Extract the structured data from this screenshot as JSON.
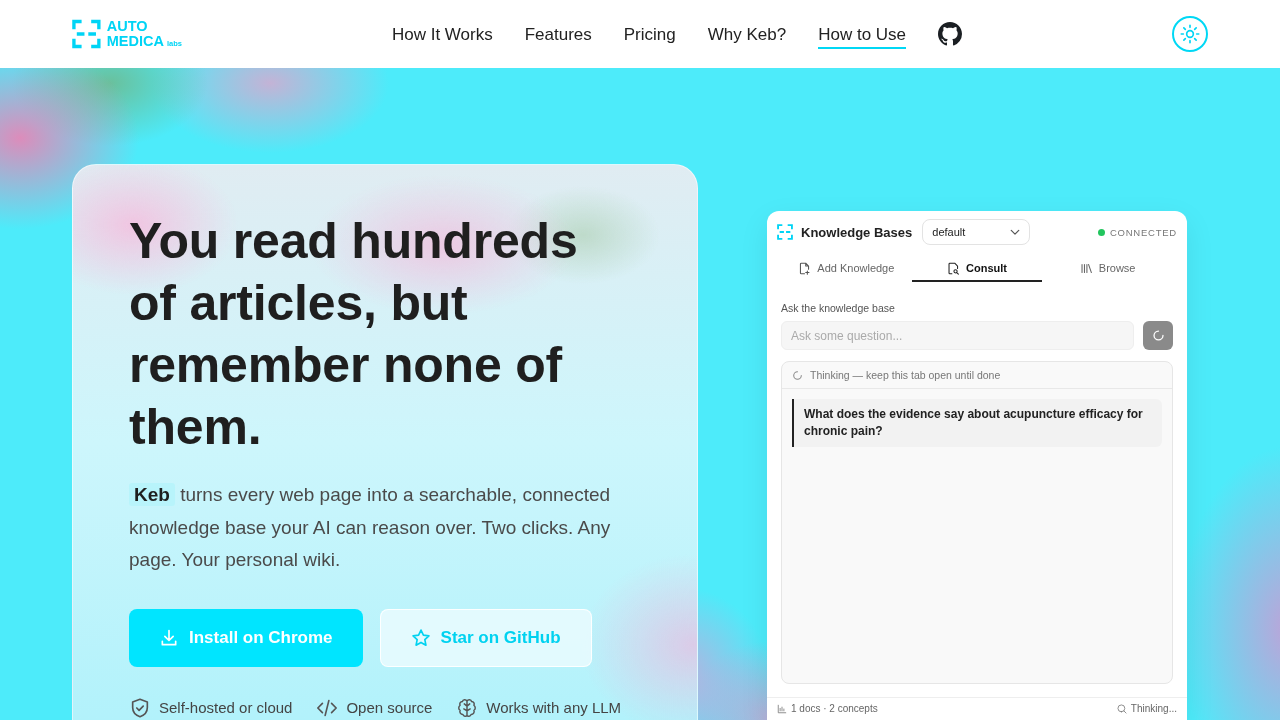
{
  "header": {
    "logo": {
      "line_1": "AUTO",
      "line_2": "MEDICA",
      "suffix": "labs"
    },
    "nav": [
      {
        "label": "How It Works",
        "selected": false
      },
      {
        "label": "Features",
        "selected": false
      },
      {
        "label": "Pricing",
        "selected": false
      },
      {
        "label": "Why Keb?",
        "selected": false
      },
      {
        "label": "How to Use",
        "selected": true
      }
    ]
  },
  "hero": {
    "headline": "You read hundreds of articles, but remember none of them.",
    "description": "**Keb** turns every web page into a searchable, connected knowledge base your AI can reason over. Two clicks. Any page. Your personal wiki.",
    "buttons": [
      {
        "kind": "primary",
        "label": "Install on Chrome"
      },
      {
        "kind": "secondary",
        "label": "Star on GitHub"
      }
    ],
    "features": [
      "Self-hosted or cloud",
      "Open source",
      "Works with any LLM"
    ]
  },
  "panel": {
    "title": "Knowledge Bases",
    "select": {
      "value": "default"
    },
    "status": "CONNECTED",
    "tabs": [
      {
        "label": "Add Knowledge",
        "selected": false
      },
      {
        "label": "Consult",
        "selected": true
      },
      {
        "label": "Browse",
        "selected": false
      }
    ],
    "field_label": "Ask the knowledge base",
    "input": {
      "placeholder": "Ask some question..."
    },
    "result": {
      "status": "Thinking — keep this tab open until done",
      "question": "What does the evidence say about acupuncture efficacy for chronic pain?"
    },
    "footer": {
      "stats": "1 docs · 2 concepts",
      "status": "Thinking..."
    }
  }
}
